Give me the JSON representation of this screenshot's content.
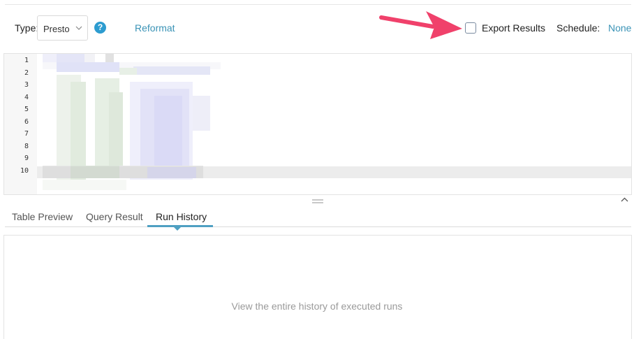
{
  "toolbar": {
    "type_label": "Type:",
    "engine_value": "Presto",
    "help_glyph": "?",
    "reformat_label": "Reformat",
    "export_results_label": "Export Results",
    "export_results_checked": false,
    "schedule_label": "Schedule:",
    "schedule_value": "None"
  },
  "editor": {
    "line_numbers": [
      "1",
      "2",
      "3",
      "4",
      "5",
      "6",
      "7",
      "8",
      "9",
      "10"
    ],
    "active_line": 10,
    "code_state": "pixelated/redacted"
  },
  "annotation": {
    "arrow_color": "#f0416b",
    "arrow_target": "export-results-checkbox"
  },
  "tabs": [
    {
      "label": "Table Preview",
      "active": false
    },
    {
      "label": "Query Result",
      "active": false
    },
    {
      "label": "Run History",
      "active": true
    }
  ],
  "panel": {
    "empty_message": "View the entire history of executed runs"
  },
  "colors": {
    "link": "#3a93b6",
    "accent": "#4fa0c2",
    "help_icon": "#2d9cd0"
  },
  "icons": [
    "question-circle-icon",
    "chevron-down-icon",
    "drag-handle-icon",
    "chevron-up-icon",
    "arrow-pointer-icon"
  ]
}
